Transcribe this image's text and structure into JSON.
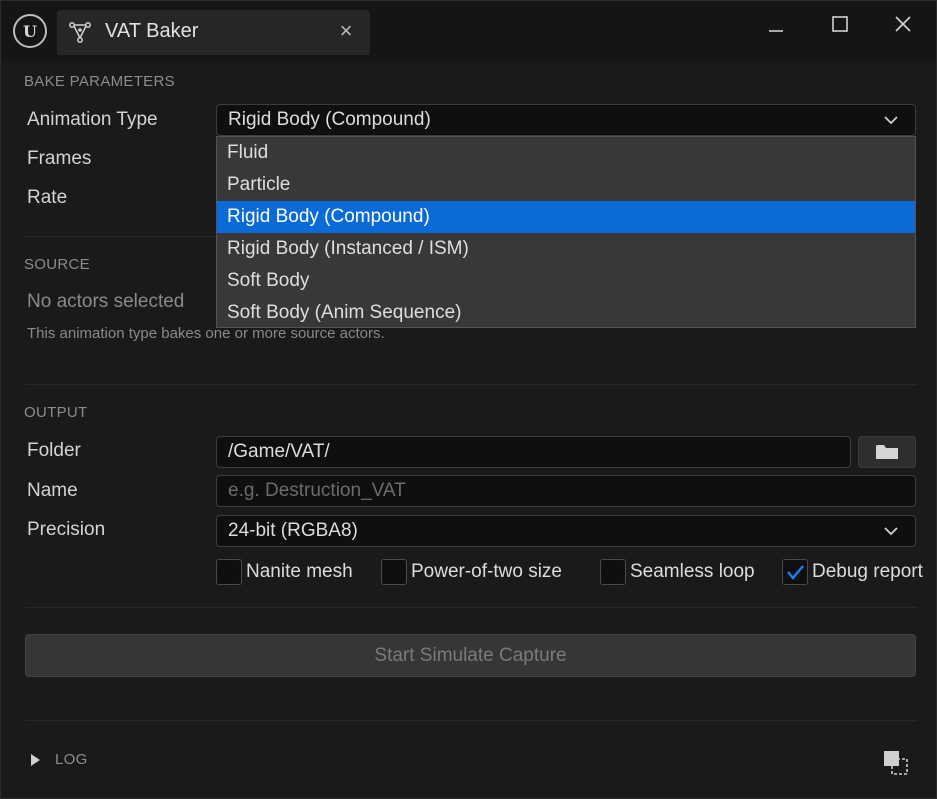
{
  "window": {
    "tab_title": "VAT Baker",
    "tab_close": "×"
  },
  "bake": {
    "section": "BAKE PARAMETERS",
    "animation_type_label": "Animation Type",
    "animation_type_value": "Rigid Body (Compound)",
    "frames_label": "Frames",
    "rate_label": "Rate",
    "options": [
      "Fluid",
      "Particle",
      "Rigid Body (Compound)",
      "Rigid Body (Instanced / ISM)",
      "Soft Body",
      "Soft Body (Anim Sequence)"
    ],
    "selected_index": 2
  },
  "source": {
    "section": "SOURCE",
    "status": "No actors selected",
    "hint": "This animation type bakes one or more source actors."
  },
  "output": {
    "section": "OUTPUT",
    "folder_label": "Folder",
    "folder_value": "/Game/VAT/",
    "name_label": "Name",
    "name_placeholder": "e.g. Destruction_VAT",
    "precision_label": "Precision",
    "precision_value": "24-bit (RGBA8)",
    "checkboxes": [
      {
        "label": "Nanite mesh",
        "checked": false
      },
      {
        "label": "Power-of-two size",
        "checked": false
      },
      {
        "label": "Seamless loop",
        "checked": false
      },
      {
        "label": "Debug report",
        "checked": true
      }
    ]
  },
  "actions": {
    "start_label": "Start Simulate Capture"
  },
  "log": {
    "label": "LOG"
  },
  "colors": {
    "accent": "#0a6bd8",
    "background": "#1a1a1a"
  }
}
